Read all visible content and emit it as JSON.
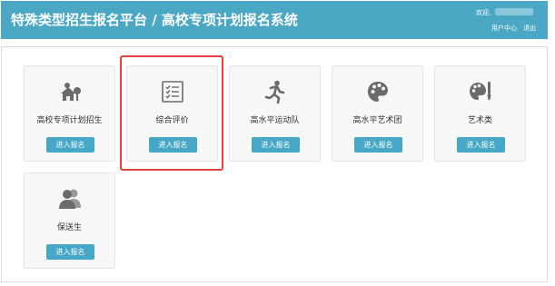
{
  "header": {
    "title": "特殊类型招生报名平台 / 高校专项计划报名系统",
    "welcome": "欢迎,",
    "user_center": "用户中心",
    "logout": "退出"
  },
  "cards": [
    {
      "label": "高校专项计划招生",
      "button": "进入报名",
      "icon": "house-tree-icon"
    },
    {
      "label": "综合评价",
      "button": "进入报名",
      "icon": "checklist-icon"
    },
    {
      "label": "高水平运动队",
      "button": "进入报名",
      "icon": "runner-icon"
    },
    {
      "label": "高水平艺术团",
      "button": "进入报名",
      "icon": "palette-icon"
    },
    {
      "label": "艺术类",
      "button": "进入报名",
      "icon": "palette-brush-icon"
    },
    {
      "label": "保送生",
      "button": "进入报名",
      "icon": "users-icon"
    }
  ],
  "colors": {
    "header": "#4aa8c4",
    "button": "#47a7c7",
    "highlight": "#e0453b",
    "icon": "#6b6b6b"
  }
}
